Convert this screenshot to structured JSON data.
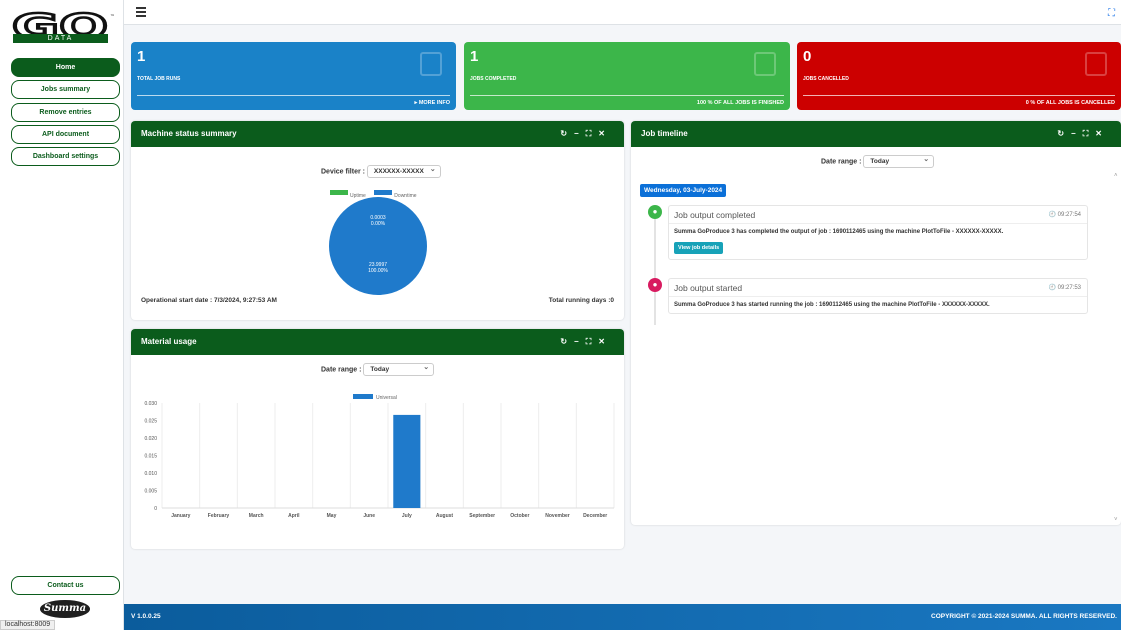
{
  "logo": {
    "word": "GO",
    "sub": "DATA"
  },
  "nav": [
    {
      "label": "Home"
    },
    {
      "label": "Jobs summary"
    },
    {
      "label": "Remove entries"
    },
    {
      "label": "API document"
    },
    {
      "label": "Dashboard settings"
    }
  ],
  "contact_label": "Contact us",
  "brand": "Summa",
  "status_url": "localhost:8009",
  "info_boxes": [
    {
      "value": "1",
      "label": "TOTAL JOB RUNS",
      "footer": "▸ MORE INFO",
      "color": "#1a82c8"
    },
    {
      "value": "1",
      "label": "JOBS COMPLETED",
      "footer": "100 % OF ALL JOBS IS FINISHED",
      "color": "#3cb64a"
    },
    {
      "value": "0",
      "label": "JOBS CANCELLED",
      "footer": "0 % OF ALL JOBS IS CANCELLED",
      "color": "#cc0000"
    }
  ],
  "machine_status": {
    "title": "Machine status summary",
    "filter_label": "Device filter :",
    "filter_value": "XXXXXX-XXXXX",
    "legend": [
      {
        "label": "Uptime",
        "color": "#3cb64a"
      },
      {
        "label": "Downtime",
        "color": "#1f7acb"
      }
    ],
    "uptime_hours": "0.0003",
    "uptime_percent": "0.00%",
    "downtime_hours": "23.9997",
    "downtime_percent": "100.00%",
    "start_date": "Operational start date : 7/3/2024, 9:27:53 AM",
    "running_days": "Total running days :0"
  },
  "material_usage": {
    "title": "Material usage",
    "date_label": "Date range :",
    "date_value": "Today"
  },
  "chart_data": {
    "type": "bar",
    "categories": [
      "January",
      "February",
      "March",
      "April",
      "May",
      "June",
      "July",
      "August",
      "September",
      "October",
      "November",
      "December"
    ],
    "series": [
      {
        "name": "Universal",
        "values": [
          0,
          0,
          0,
          0,
          0,
          0,
          0.0266,
          0,
          0,
          0,
          0,
          0
        ]
      }
    ],
    "yticks": [
      "0.030",
      "0.025",
      "0.020",
      "0.015",
      "0.010",
      "0.005",
      "0"
    ],
    "ylim": [
      0,
      0.03
    ],
    "color": "#1f7acb"
  },
  "timeline": {
    "title": "Job timeline",
    "date_label": "Date range :",
    "date_value": "Today",
    "date_pill": "Wednesday, 03-July-2024",
    "items": [
      {
        "title": "Job output completed",
        "time": "09:27:54",
        "body": "Summa GoProduce 3 has completed the output of job : 1690112465 using the machine PlotToFile - XXXXXX-XXXXX.",
        "button": "View job details",
        "color": "#3cb64a"
      },
      {
        "title": "Job output started",
        "time": "09:27:53",
        "body": "Summa GoProduce 3 has started running the job : 1690112465 using the machine PlotToFile - XXXXXX-XXXXX.",
        "color": "#d81b60"
      }
    ]
  },
  "footer": {
    "version": "V 1.0.0.25",
    "copyright": "COPYRIGHT © 2021-2024 SUMMA. ALL RIGHTS RESERVED."
  }
}
